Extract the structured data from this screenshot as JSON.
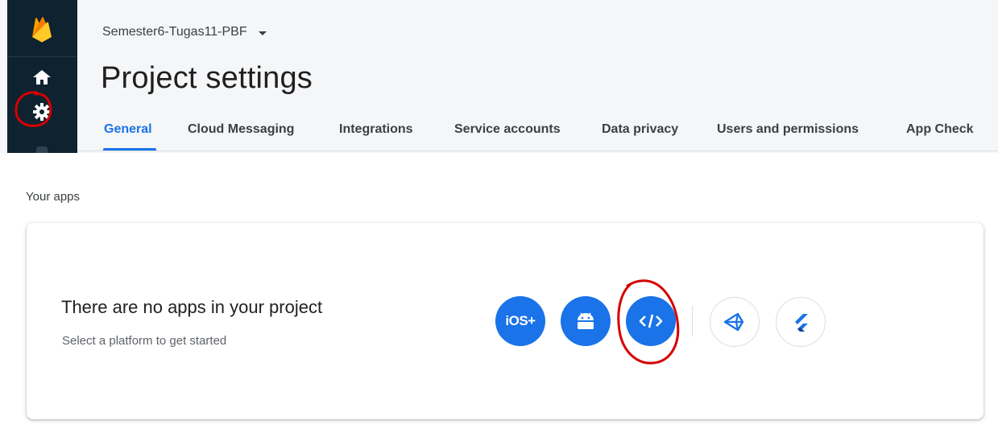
{
  "header": {
    "project_name": "Semester6-Tugas11-PBF",
    "page_title": "Project settings"
  },
  "rail": {
    "icons": [
      "firebase-logo",
      "home-icon",
      "gear-icon"
    ]
  },
  "tabs": [
    {
      "label": "General",
      "active": true
    },
    {
      "label": "Cloud Messaging",
      "active": false
    },
    {
      "label": "Integrations",
      "active": false
    },
    {
      "label": "Service accounts",
      "active": false
    },
    {
      "label": "Data privacy",
      "active": false
    },
    {
      "label": "Users and permissions",
      "active": false
    },
    {
      "label": "App Check",
      "active": false
    }
  ],
  "apps": {
    "section_label": "Your apps",
    "empty_title": "There are no apps in your project",
    "empty_subtitle": "Select a platform to get started",
    "platforms": [
      {
        "name": "ios",
        "label": "iOS+",
        "style": "filled"
      },
      {
        "name": "android",
        "label": "",
        "style": "filled"
      },
      {
        "name": "web",
        "label": "</>",
        "style": "filled"
      },
      {
        "name": "unity",
        "label": "",
        "style": "outline"
      },
      {
        "name": "flutter",
        "label": "",
        "style": "outline"
      }
    ]
  },
  "colors": {
    "accent": "#1a73e8",
    "rail_bg": "#0f2230",
    "annotation": "#d50000"
  }
}
